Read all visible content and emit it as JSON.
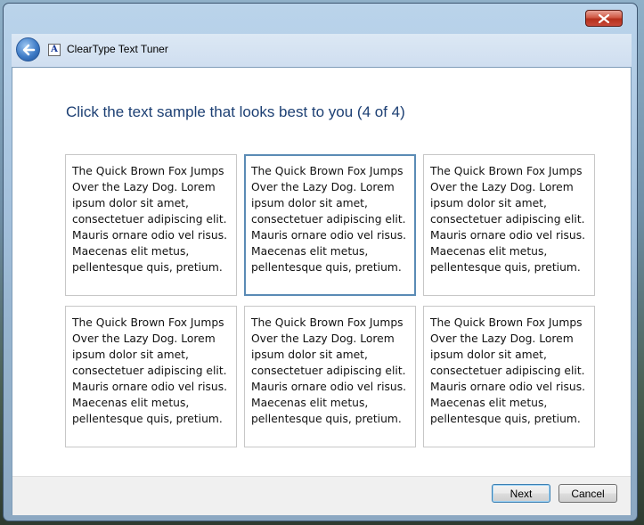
{
  "window": {
    "title": "ClearType Text Tuner",
    "accent": "#1c3f73"
  },
  "instruction": "Click the text sample that looks best to you (4 of 4)",
  "samples": [
    {
      "text": "The Quick Brown Fox Jumps Over the Lazy Dog. Lorem ipsum dolor sit amet, consectetuer adipiscing elit. Mauris ornare odio vel risus. Maecenas elit metus, pellentesque quis, pretium.",
      "selected": false
    },
    {
      "text": "The Quick Brown Fox Jumps Over the Lazy Dog. Lorem ipsum dolor sit amet, consectetuer adipiscing elit. Mauris ornare odio vel risus. Maecenas elit metus, pellentesque quis, pretium.",
      "selected": true
    },
    {
      "text": "The Quick Brown Fox Jumps Over the Lazy Dog. Lorem ipsum dolor sit amet, consectetuer adipiscing elit. Mauris ornare odio vel risus. Maecenas elit metus, pellentesque quis, pretium.",
      "selected": false
    },
    {
      "text": "The Quick Brown Fox Jumps Over the Lazy Dog. Lorem ipsum dolor sit amet, consectetuer adipiscing elit. Mauris ornare odio vel risus. Maecenas elit metus, pellentesque quis, pretium.",
      "selected": false
    },
    {
      "text": "The Quick Brown Fox Jumps Over the Lazy Dog. Lorem ipsum dolor sit amet, consectetuer adipiscing elit. Mauris ornare odio vel risus. Maecenas elit metus, pellentesque quis, pretium.",
      "selected": false
    },
    {
      "text": "The Quick Brown Fox Jumps Over the Lazy Dog. Lorem ipsum dolor sit amet, consectetuer adipiscing elit. Mauris ornare odio vel risus. Maecenas elit metus, pellentesque quis, pretium.",
      "selected": false
    }
  ],
  "buttons": {
    "next": "Next",
    "cancel": "Cancel"
  },
  "icons": {
    "close": "close-icon",
    "back": "back-arrow-icon",
    "app": "cleartype-app-icon"
  }
}
